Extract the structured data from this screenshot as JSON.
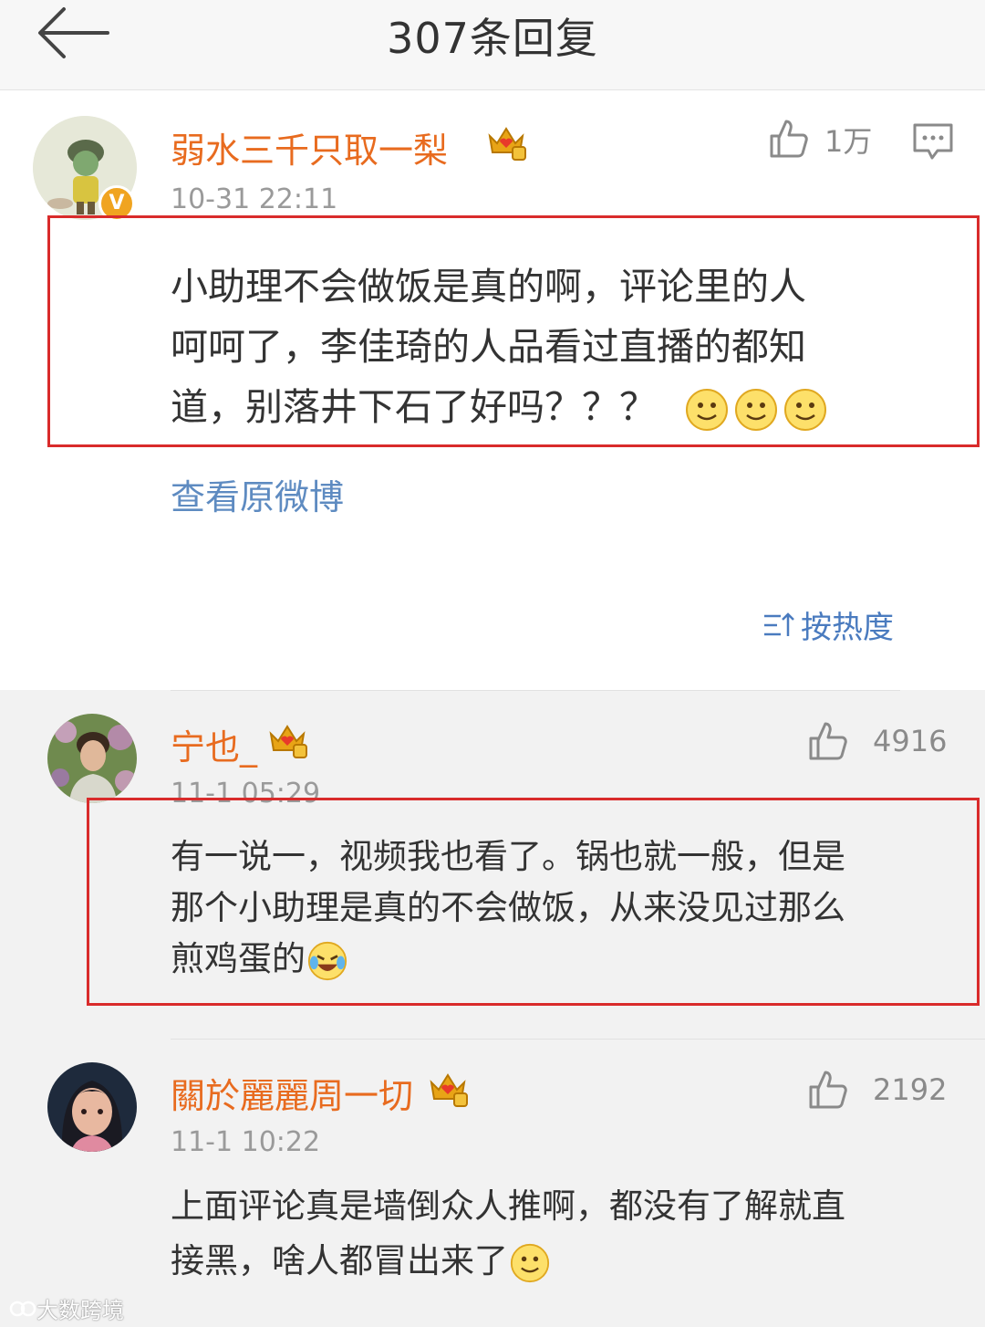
{
  "header": {
    "title": "307条回复"
  },
  "main_comment": {
    "username": "弱水三千只取一梨",
    "timestamp": "10-31 22:11",
    "like_count": "1万",
    "text_lines": [
      "小助理不会做饭是真的啊，评论里的人",
      "呵呵了，李佳琦的人品看过直播的都知",
      "道，别落井下石了好吗？？？"
    ],
    "view_original": "查看原微博",
    "sort_label": "按热度"
  },
  "replies": [
    {
      "username": "宁也_",
      "timestamp": "11-1 05:29",
      "like_count": "4916",
      "text_lines": [
        "有一说一，视频我也看了。锅也就一般，但是",
        "那个小助理是真的不会做饭，从来没见过那么",
        "煎鸡蛋的"
      ]
    },
    {
      "username": "關於麗麗周一切",
      "timestamp": "11-1 10:22",
      "like_count": "2192",
      "text_lines": [
        "上面评论真是墙倒众人推啊，都没有了解就直",
        "接黑，啥人都冒出来了"
      ]
    }
  ],
  "watermark": "大数跨境",
  "colors": {
    "username": "#e86b1f",
    "link": "#5e8bc1",
    "highlight": "#d92b2b"
  }
}
